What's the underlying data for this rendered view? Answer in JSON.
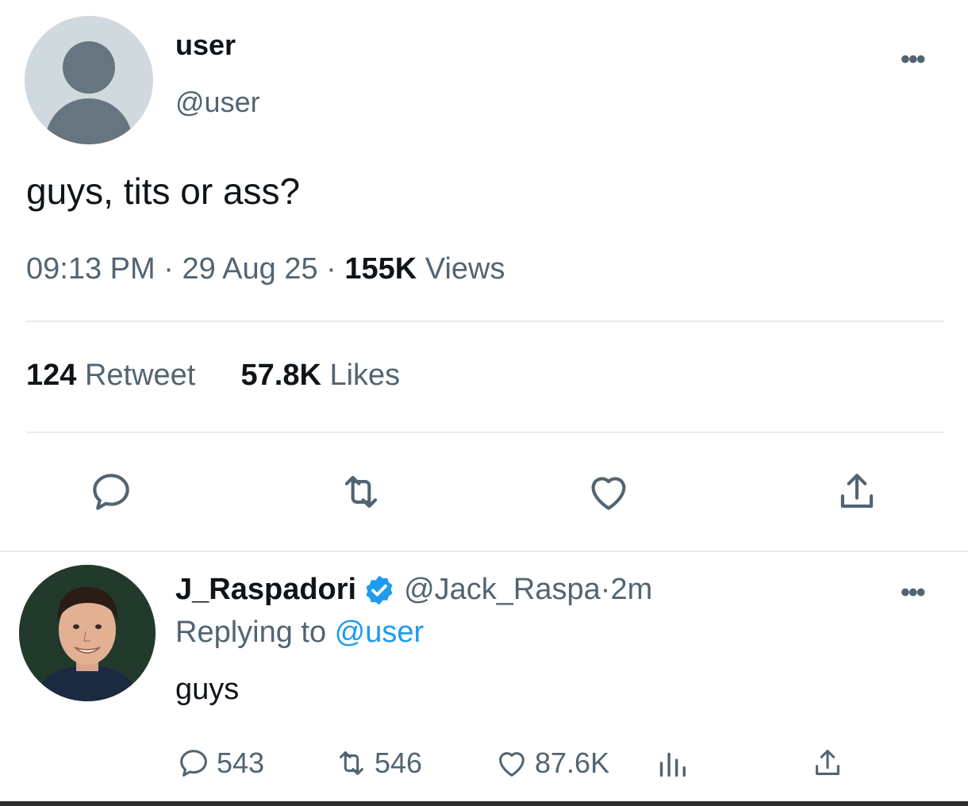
{
  "tweet": {
    "author_name": "user",
    "author_handle": "@user",
    "more_label": "•••",
    "text": "guys, tits or ass?",
    "time": "09:13 PM",
    "sep1": " · ",
    "date": "29 Aug 25",
    "sep2": " · ",
    "views_count": "155K",
    "views_label": " Views",
    "retweet_count": "124",
    "retweet_label": " Retweet",
    "likes_count": "57.8K",
    "likes_label": " Likes"
  },
  "reply": {
    "author_name": "J_Raspadori",
    "author_handle": "@Jack_Raspa",
    "sep": " · ",
    "time": "2m",
    "more_label": "•••",
    "replying_prefix": "Replying to ",
    "replying_handle": "@user",
    "text": "guys",
    "reply_count": "543",
    "retweet_count": "546",
    "like_count": "87.6K"
  },
  "colors": {
    "text_primary": "#0f1419",
    "text_secondary": "#536471",
    "accent": "#1d9bf0",
    "divider": "#e6ecf0"
  },
  "icons": {
    "reply": "speech-bubble-icon",
    "retweet": "retweet-arrows-icon",
    "like": "heart-icon",
    "share": "share-upload-icon",
    "views": "bar-chart-icon",
    "verified": "verified-badge-icon"
  }
}
